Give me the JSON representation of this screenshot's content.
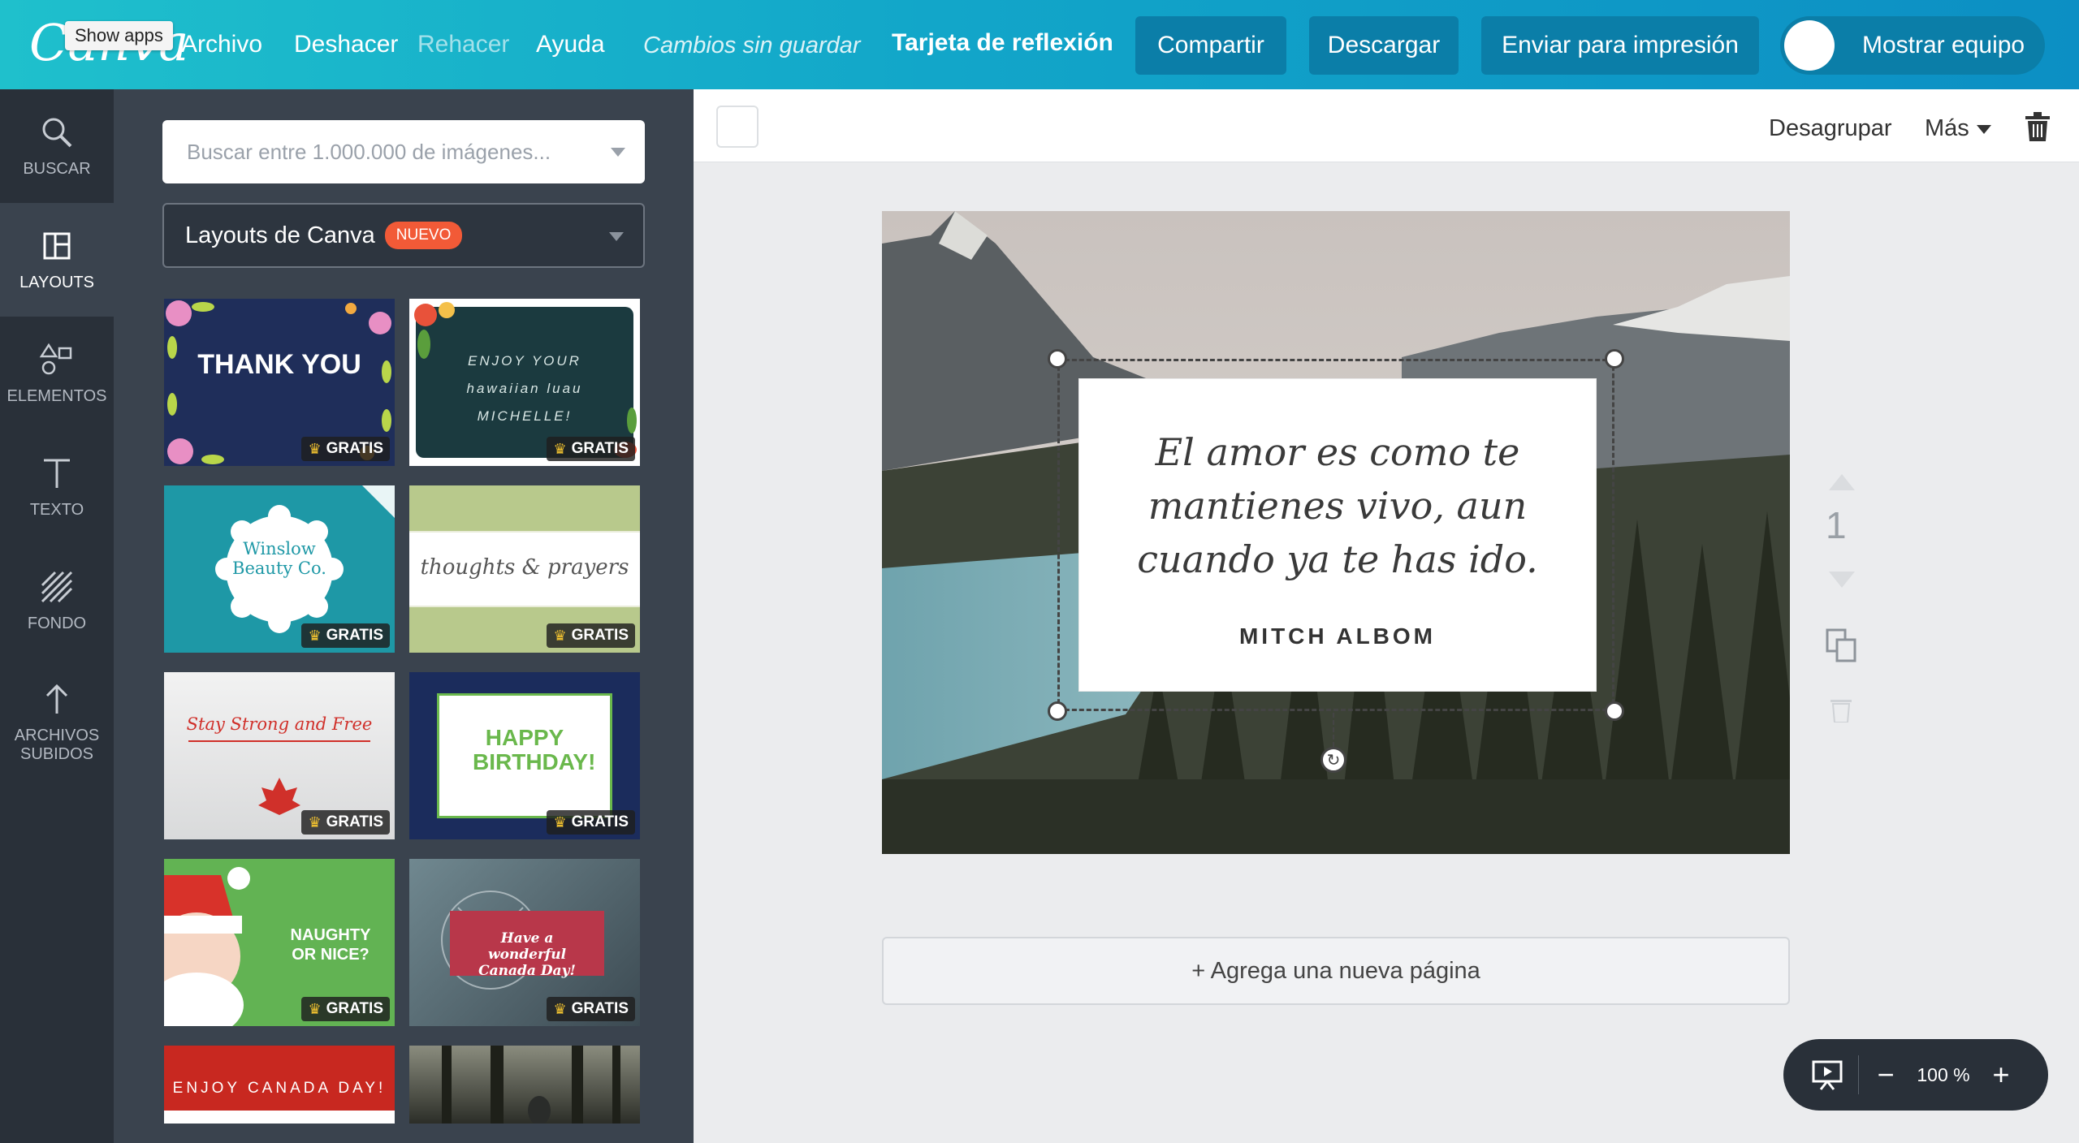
{
  "app": {
    "logo": "Canva",
    "tooltip": "Show apps",
    "menu": [
      "Archivo",
      "Deshacer",
      "Rehacer",
      "Ayuda"
    ],
    "unsaved_status": "Cambios sin guardar",
    "doc_title": "Tarjeta de reflexión",
    "buttons": {
      "share": "Compartir",
      "download": "Descargar",
      "print": "Enviar para impresión",
      "team": "Mostrar equipo"
    }
  },
  "rail": [
    {
      "label": "BUSCAR",
      "icon": "search-icon"
    },
    {
      "label": "LAYOUTS",
      "icon": "layouts-icon",
      "active": true
    },
    {
      "label": "ELEMENTOS",
      "icon": "shapes-icon"
    },
    {
      "label": "TEXTO",
      "icon": "text-icon"
    },
    {
      "label": "FONDO",
      "icon": "background-icon"
    },
    {
      "label": "ARCHIVOS SUBIDOS",
      "icon": "upload-icon"
    }
  ],
  "panel": {
    "search_placeholder": "Buscar entre 1.000.000 de imágenes...",
    "layouts_label": "Layouts de Canva",
    "new_badge": "NUEVO",
    "free_label": "GRATIS",
    "templates": [
      {
        "title": "THANK YOU",
        "bg": "#1f2e5a"
      },
      {
        "title": "ENJOY YOUR hawaiian luau MICHELLE!",
        "bg": "#1b3a3f"
      },
      {
        "title": "Winslow Beauty Co.",
        "bg": "#1e98a6"
      },
      {
        "title": "thoughts & prayers",
        "bg": "#e9ecd9"
      },
      {
        "title": "Stay Strong and Free",
        "bg": "#e8e8e8"
      },
      {
        "title": "HAPPY BIRTHDAY!",
        "bg": "#1b2c5c"
      },
      {
        "title": "NAUGHTY OR NICE?",
        "bg": "#62b353"
      },
      {
        "title": "Have a wonderful Canada Day!",
        "bg": "#5c7078"
      },
      {
        "title": "ENJOY CANADA DAY!",
        "bg": "#c82820"
      },
      {
        "title": "",
        "bg": "#3a3c36"
      }
    ]
  },
  "toolbar": {
    "ungroup": "Desagrupar",
    "more": "Más"
  },
  "design": {
    "quote": [
      "El amor es como te",
      "mantienes vivo, aun",
      "cuando ya te has ido."
    ],
    "author": "MITCH ALBOM",
    "page_number": "1"
  },
  "add_page": "+ Agrega una nueva página",
  "zoom": "100 %"
}
